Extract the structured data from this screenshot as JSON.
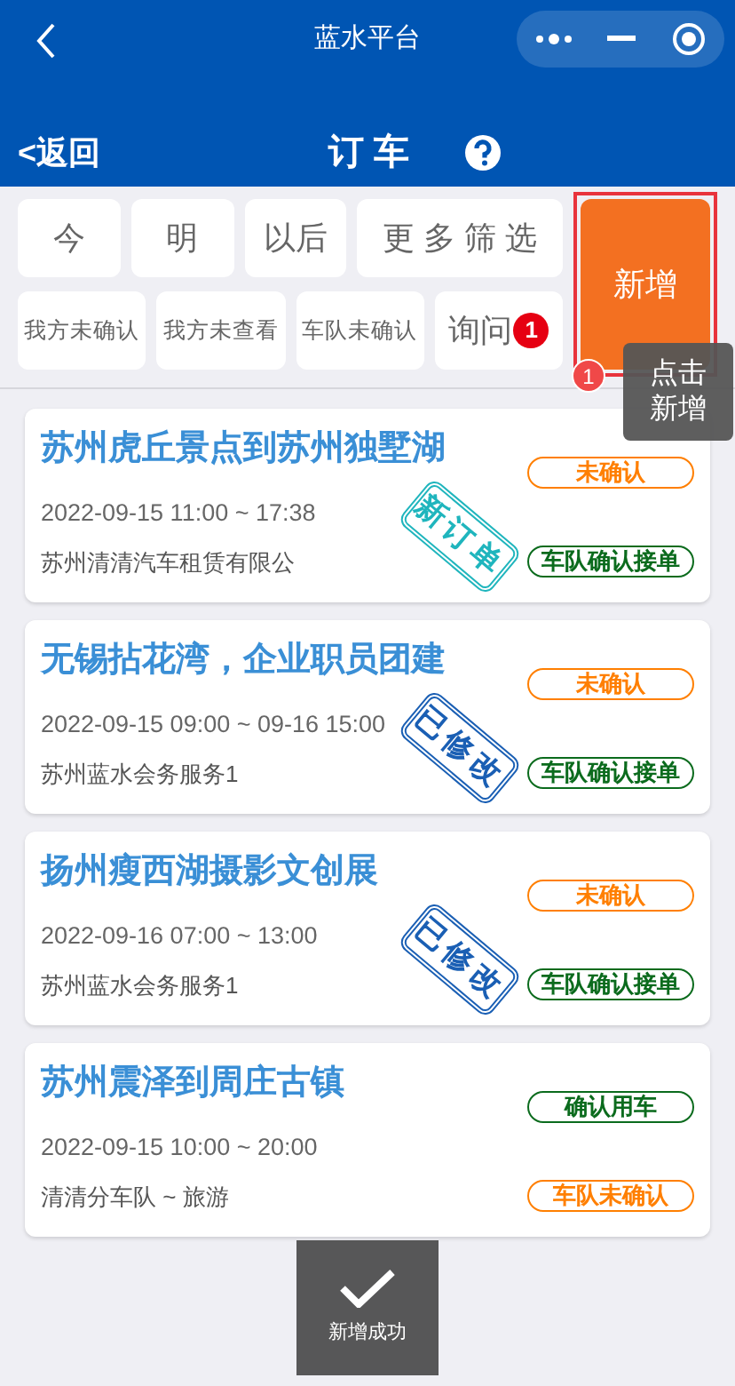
{
  "window": {
    "title": "蓝水平台"
  },
  "nav": {
    "back": "<返回",
    "title": "订 车"
  },
  "filters": [
    {
      "label": "今"
    },
    {
      "label": "明"
    },
    {
      "label": "以后"
    },
    {
      "label": "更 多 筛 选"
    }
  ],
  "status_filters": [
    {
      "label": "我方未确认"
    },
    {
      "label": "我方未查看"
    },
    {
      "label": "车队未确认"
    },
    {
      "label": "询问",
      "badge": "1"
    }
  ],
  "add_button": {
    "label": "新增",
    "highlighted": true
  },
  "guide": {
    "step": "1",
    "text": [
      "点击",
      "新增"
    ]
  },
  "orders": [
    {
      "title": "苏州虎丘景点到苏州独墅湖",
      "time": "2022-09-15 11:00 ~ 17:38",
      "company": "苏州清清汽车租赁有限公",
      "stamp": {
        "text": "新订单",
        "color": "#1fb5bd"
      },
      "tags": [
        {
          "text": "未确认",
          "color": "#ff7f00"
        },
        {
          "text": "车队确认接单",
          "color": "#0b6b1d"
        }
      ]
    },
    {
      "title": "无锡拈花湾，企业职员团建",
      "time": "2022-09-15 09:00 ~ 09-16 15:00",
      "company": "苏州蓝水会务服务1",
      "stamp": {
        "text": "已修改",
        "color": "#1a5fb4"
      },
      "tags": [
        {
          "text": "未确认",
          "color": "#ff7f00"
        },
        {
          "text": "车队确认接单",
          "color": "#0b6b1d"
        }
      ]
    },
    {
      "title": "扬州瘦西湖摄影文创展",
      "time": "2022-09-16 07:00 ~ 13:00",
      "company": "苏州蓝水会务服务1",
      "stamp": {
        "text": "已修改",
        "color": "#1a5fb4"
      },
      "tags": [
        {
          "text": "未确认",
          "color": "#ff7f00"
        },
        {
          "text": "车队确认接单",
          "color": "#0b6b1d"
        }
      ]
    },
    {
      "title": "苏州震泽到周庄古镇",
      "time": "2022-09-15 10:00 ~ 20:00",
      "company": "清清分车队 ~ 旅游",
      "tags": [
        {
          "text": "确认用车",
          "color": "#0b6b1d"
        },
        {
          "text": "车队未确认",
          "color": "#ff7f00"
        }
      ]
    }
  ],
  "toast": {
    "text": "新增成功"
  }
}
